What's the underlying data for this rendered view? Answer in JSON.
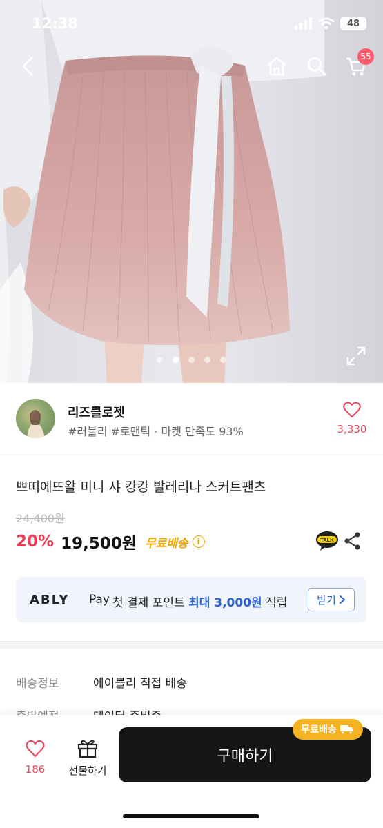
{
  "status": {
    "time": "12:38",
    "battery": "48"
  },
  "nav": {
    "cart_count": "55"
  },
  "gallery": {
    "dots": [
      {
        "active": false
      },
      {
        "active": true
      },
      {
        "active": false
      },
      {
        "active": false
      },
      {
        "active": false
      }
    ]
  },
  "seller": {
    "name": "리즈클로젯",
    "tags": "#러블리 #로맨틱 · 마켓 만족도 93%",
    "likes": "3,330"
  },
  "product": {
    "title": "쁘띠에뜨왈 미니 샤 캉캉 발레리나 스커트팬츠",
    "original_price": "24,400원",
    "discount": "20%",
    "price": "19,500원",
    "free_shipping": "무료배송",
    "info_glyph": "i",
    "talk_label": "TALK"
  },
  "ably_banner": {
    "brand": "ABLY",
    "pay": "Pay",
    "text_prefix": "첫 결제 포인트",
    "highlight": "최대 3,000원",
    "text_suffix": "적립",
    "button": "받기"
  },
  "info_rows": [
    {
      "label": "배송정보",
      "value": "에이블리 직접 배송"
    },
    {
      "label": "출발예정",
      "value": "데이터 준비중"
    }
  ],
  "bottom": {
    "like_count": "186",
    "gift_label": "선물하기",
    "buy_label": "구매하기",
    "buy_badge": "무료배송"
  },
  "colors": {
    "accent_pink": "#e94a5e",
    "discount_red": "#ee3c54",
    "ship_yellow": "#f0a800",
    "ably_blue": "#2e63c9",
    "buy_black": "#161616"
  }
}
